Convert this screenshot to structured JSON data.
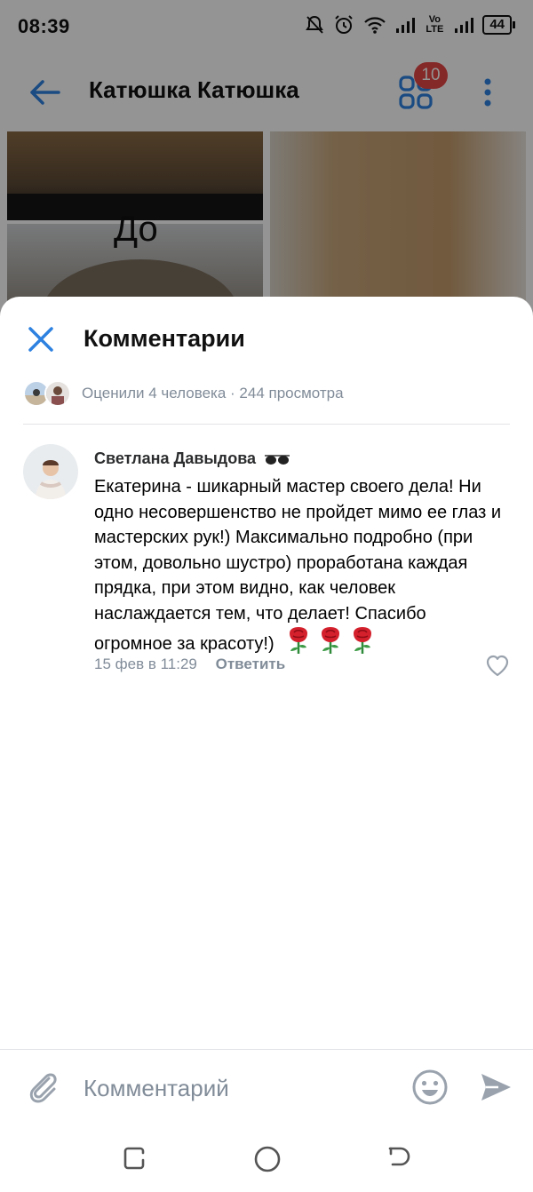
{
  "status_bar": {
    "time": "08:39",
    "battery": "44",
    "network_label": "Vo LTE"
  },
  "header": {
    "title": "Катюшка Катюшка",
    "apps_badge": "10"
  },
  "photo": {
    "before_label": "До"
  },
  "sheet": {
    "title": "Комментарии",
    "likes_summary": "Оценили 4 человека · 244 просмотра"
  },
  "comment": {
    "author": "Светлана Давыдова",
    "text": " Екатерина - шикарный мастер своего дела! Ни одно несовершенство не пройдет мимо ее глаз и мастерских рук!) Максимально подробно (при этом, довольно шустро) проработана каждая прядка, при этом видно, как человек наслаждается тем, что делает! Спасибо огромное за красоту!)",
    "date": "15 фев в 11:29",
    "reply_label": "Ответить"
  },
  "composer": {
    "placeholder": "Комментарий"
  },
  "colors": {
    "accent": "#2d81e0",
    "secondary_text": "#818c99",
    "badge": "#e64646",
    "icon_gray": "#99a2ad"
  },
  "icons": {
    "back": "arrow-left-icon",
    "apps": "apps-grid-icon",
    "more": "more-vertical-icon",
    "close": "close-icon",
    "attach": "paperclip-icon",
    "emoji": "smile-icon",
    "send": "send-icon",
    "like": "heart-outline-icon"
  }
}
